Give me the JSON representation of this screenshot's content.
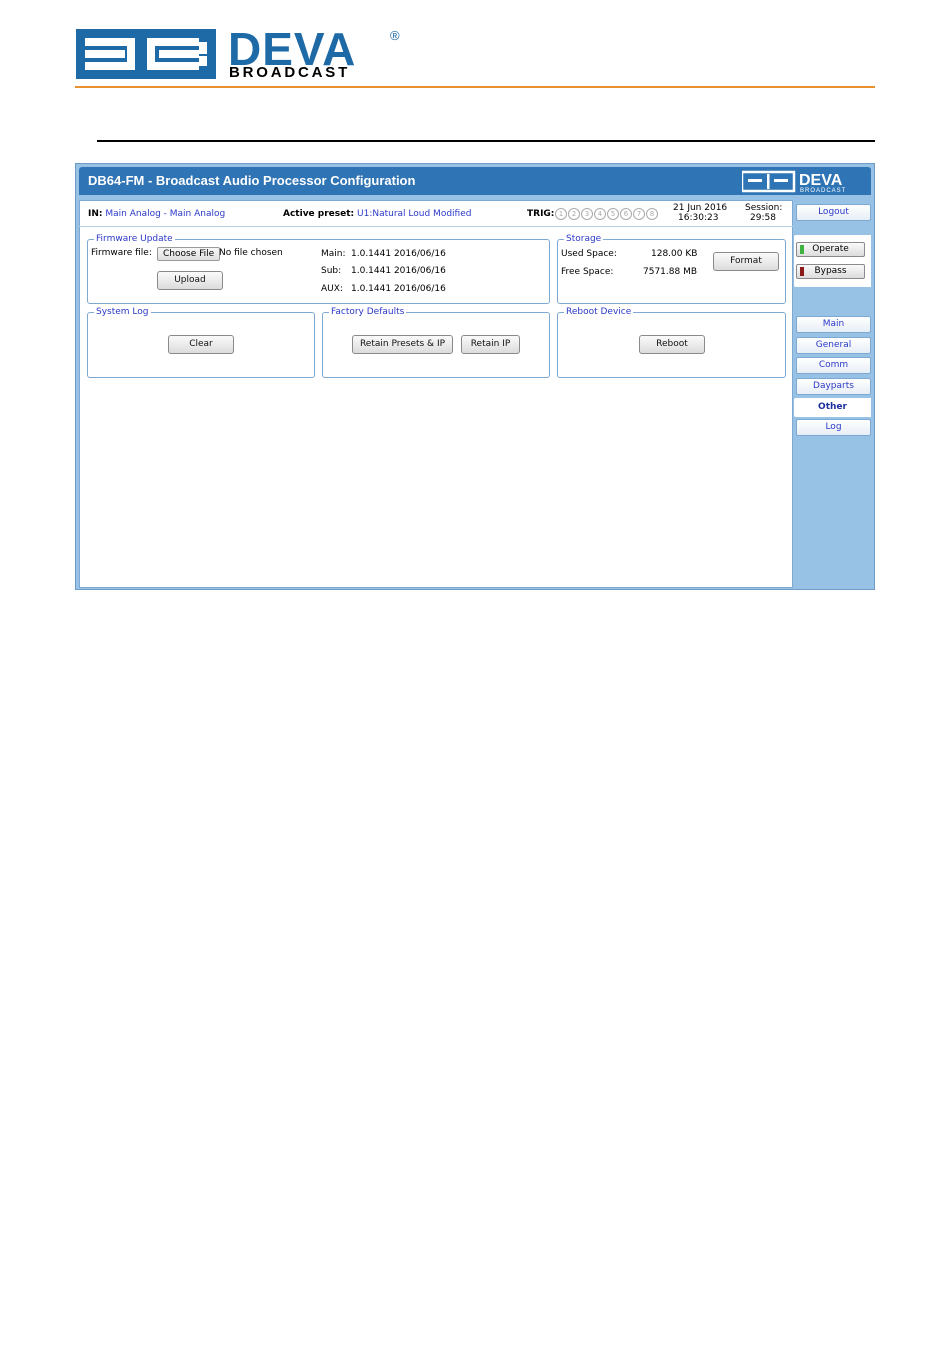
{
  "brand": {
    "logo_word": "DEVA",
    "logo_sub": "BROADCAST",
    "reg": "®"
  },
  "app": {
    "title": "DB64-FM - Broadcast Audio Processor Configuration",
    "header_logo_word": "DEVA",
    "header_logo_sub": "BROADCAST"
  },
  "status": {
    "in_label": "IN:",
    "in_value": "Main Analog - Main Analog",
    "preset_label": "Active preset:",
    "preset_value": "U1:Natural Loud Modified",
    "trig_label": "TRIG:",
    "trig_numbers": [
      "1",
      "2",
      "3",
      "4",
      "5",
      "6",
      "7",
      "8"
    ],
    "date": "21 Jun 2016",
    "time": "16:30:23",
    "session_label": "Session:",
    "session_value": "29:58"
  },
  "firmware": {
    "legend": "Firmware Update",
    "file_label": "Firmware file:",
    "choose_label": "Choose File",
    "no_file": "No file chosen",
    "upload_label": "Upload",
    "versions": [
      {
        "name": "Main:",
        "value": "1.0.1441 2016/06/16"
      },
      {
        "name": "Sub:",
        "value": "1.0.1441 2016/06/16"
      },
      {
        "name": "AUX:",
        "value": "1.0.1441 2016/06/16"
      }
    ]
  },
  "storage": {
    "legend": "Storage",
    "used_label": "Used Space:",
    "used_value": "128.00 KB",
    "free_label": "Free Space:",
    "free_value": "7571.88 MB",
    "format_label": "Format"
  },
  "system_log": {
    "legend": "System Log",
    "clear_label": "Clear"
  },
  "factory": {
    "legend": "Factory Defaults",
    "retain_presets_ip": "Retain Presets & IP",
    "retain_ip": "Retain IP"
  },
  "reboot": {
    "legend": "Reboot Device",
    "reboot_label": "Reboot"
  },
  "sidebar": {
    "logout": "Logout",
    "operate": "Operate",
    "bypass": "Bypass",
    "operate_led": "#3fb23f",
    "bypass_led": "#8b1a1a",
    "nav": [
      "Main",
      "General",
      "Comm",
      "Dayparts",
      "Other",
      "Log"
    ],
    "active": "Other"
  },
  "colors": {
    "accent": "#2f74b4",
    "rule": "#e8912f"
  }
}
